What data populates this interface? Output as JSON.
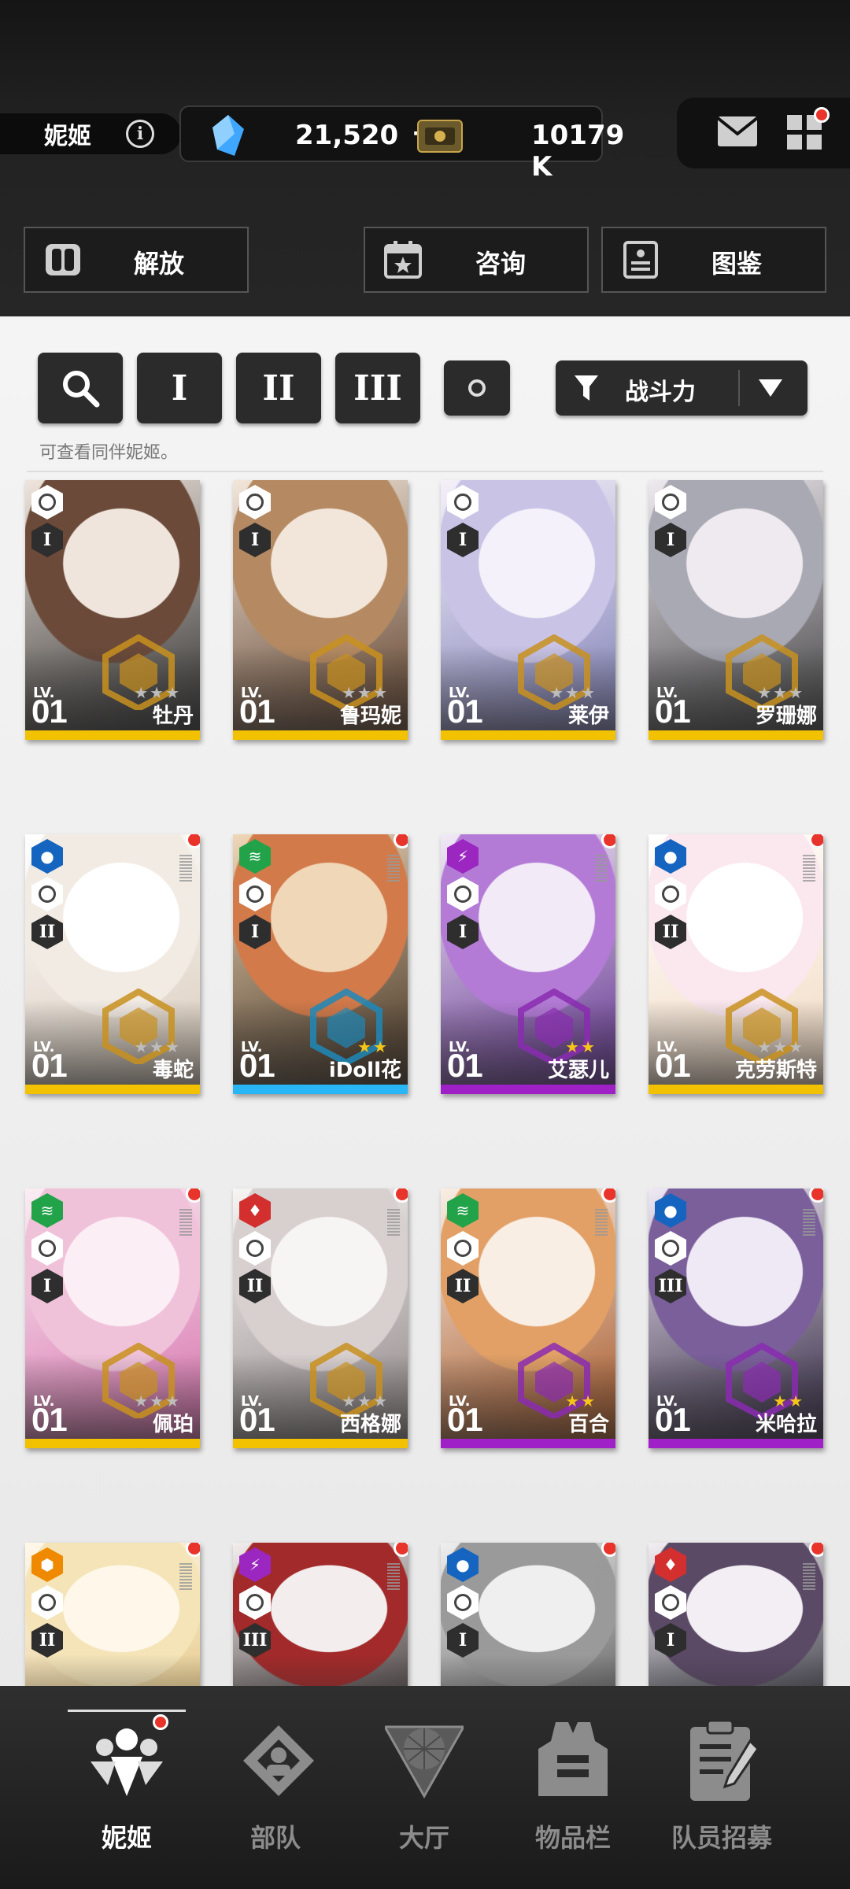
{
  "header": {
    "username": "妮姬",
    "info_symbol": "i",
    "gems": "21,520",
    "gems_plus": "+",
    "credits": "10179 K",
    "buttons": {
      "release": "解放",
      "consult": "咨询",
      "collection": "图鉴"
    }
  },
  "filters": {
    "class_1": "I",
    "class_2": "II",
    "class_3": "III",
    "sort_label": "战斗力",
    "hint": "可查看同伴妮姬。"
  },
  "cards": [
    {
      "lv_label": "LV.",
      "level": "01",
      "name": "牡丹",
      "burst": "I",
      "bar": "#f2c200",
      "stars": "★★★",
      "emblem": "#c8901e"
    },
    {
      "lv_label": "LV.",
      "level": "01",
      "name": "鲁玛妮",
      "burst": "I",
      "bar": "#f2c200",
      "stars": "★★★",
      "emblem": "#c8901e"
    },
    {
      "lv_label": "LV.",
      "level": "01",
      "name": "莱伊",
      "burst": "I",
      "bar": "#f2c200",
      "stars": "★★★",
      "emblem": "#c8901e"
    },
    {
      "lv_label": "LV.",
      "level": "01",
      "name": "罗珊娜",
      "burst": "I",
      "bar": "#f2c200",
      "stars": "★★★",
      "emblem": "#c8901e"
    },
    {
      "lv_label": "LV.",
      "level": "01",
      "name": "毒蛇",
      "burst": "II",
      "bar": "#f2c200",
      "stars": "★★★",
      "emblem": "#c8901e"
    },
    {
      "lv_label": "LV.",
      "level": "01",
      "name": "iDoll花",
      "burst": "I",
      "bar": "#29b6f6",
      "stars": "★★",
      "emblem": "#1e88b8"
    },
    {
      "lv_label": "LV.",
      "level": "01",
      "name": "艾瑟儿",
      "burst": "I",
      "bar": "#a020c8",
      "stars": "★★",
      "emblem": "#8a2cb0"
    },
    {
      "lv_label": "LV.",
      "level": "01",
      "name": "克劳斯特",
      "burst": "II",
      "bar": "#f2c200",
      "stars": "★★★",
      "emblem": "#c8901e"
    },
    {
      "lv_label": "LV.",
      "level": "01",
      "name": "佩珀",
      "burst": "I",
      "bar": "#f2c200",
      "stars": "★★★",
      "emblem": "#c8901e"
    },
    {
      "lv_label": "LV.",
      "level": "01",
      "name": "西格娜",
      "burst": "II",
      "bar": "#f2c200",
      "stars": "★★★",
      "emblem": "#c8901e"
    },
    {
      "lv_label": "LV.",
      "level": "01",
      "name": "百合",
      "burst": "II",
      "bar": "#a020c8",
      "stars": "★★",
      "emblem": "#8a2cb0"
    },
    {
      "lv_label": "LV.",
      "level": "01",
      "name": "米哈拉",
      "burst": "III",
      "bar": "#a020c8",
      "stars": "★★",
      "emblem": "#8a2cb0"
    },
    {
      "lv_label": "",
      "level": "",
      "name": "",
      "burst": "II",
      "bar": "",
      "stars": "",
      "emblem": ""
    },
    {
      "lv_label": "",
      "level": "",
      "name": "",
      "burst": "III",
      "bar": "",
      "stars": "",
      "emblem": ""
    },
    {
      "lv_label": "",
      "level": "",
      "name": "",
      "burst": "I",
      "bar": "",
      "stars": "",
      "emblem": ""
    },
    {
      "lv_label": "",
      "level": "",
      "name": "",
      "burst": "I",
      "bar": "",
      "stars": "",
      "emblem": ""
    }
  ],
  "nav": {
    "nikke": "妮姬",
    "squad": "部队",
    "lobby": "大厅",
    "inventory": "物品栏",
    "recruit": "队员招募"
  },
  "colors": {
    "accent_red": "#e8342b",
    "elem_water": "#1565c0",
    "elem_wind": "#22a34a",
    "elem_electric": "#9b26c0",
    "elem_fire": "#d32f2f",
    "elem_iron": "#ef8a00"
  }
}
